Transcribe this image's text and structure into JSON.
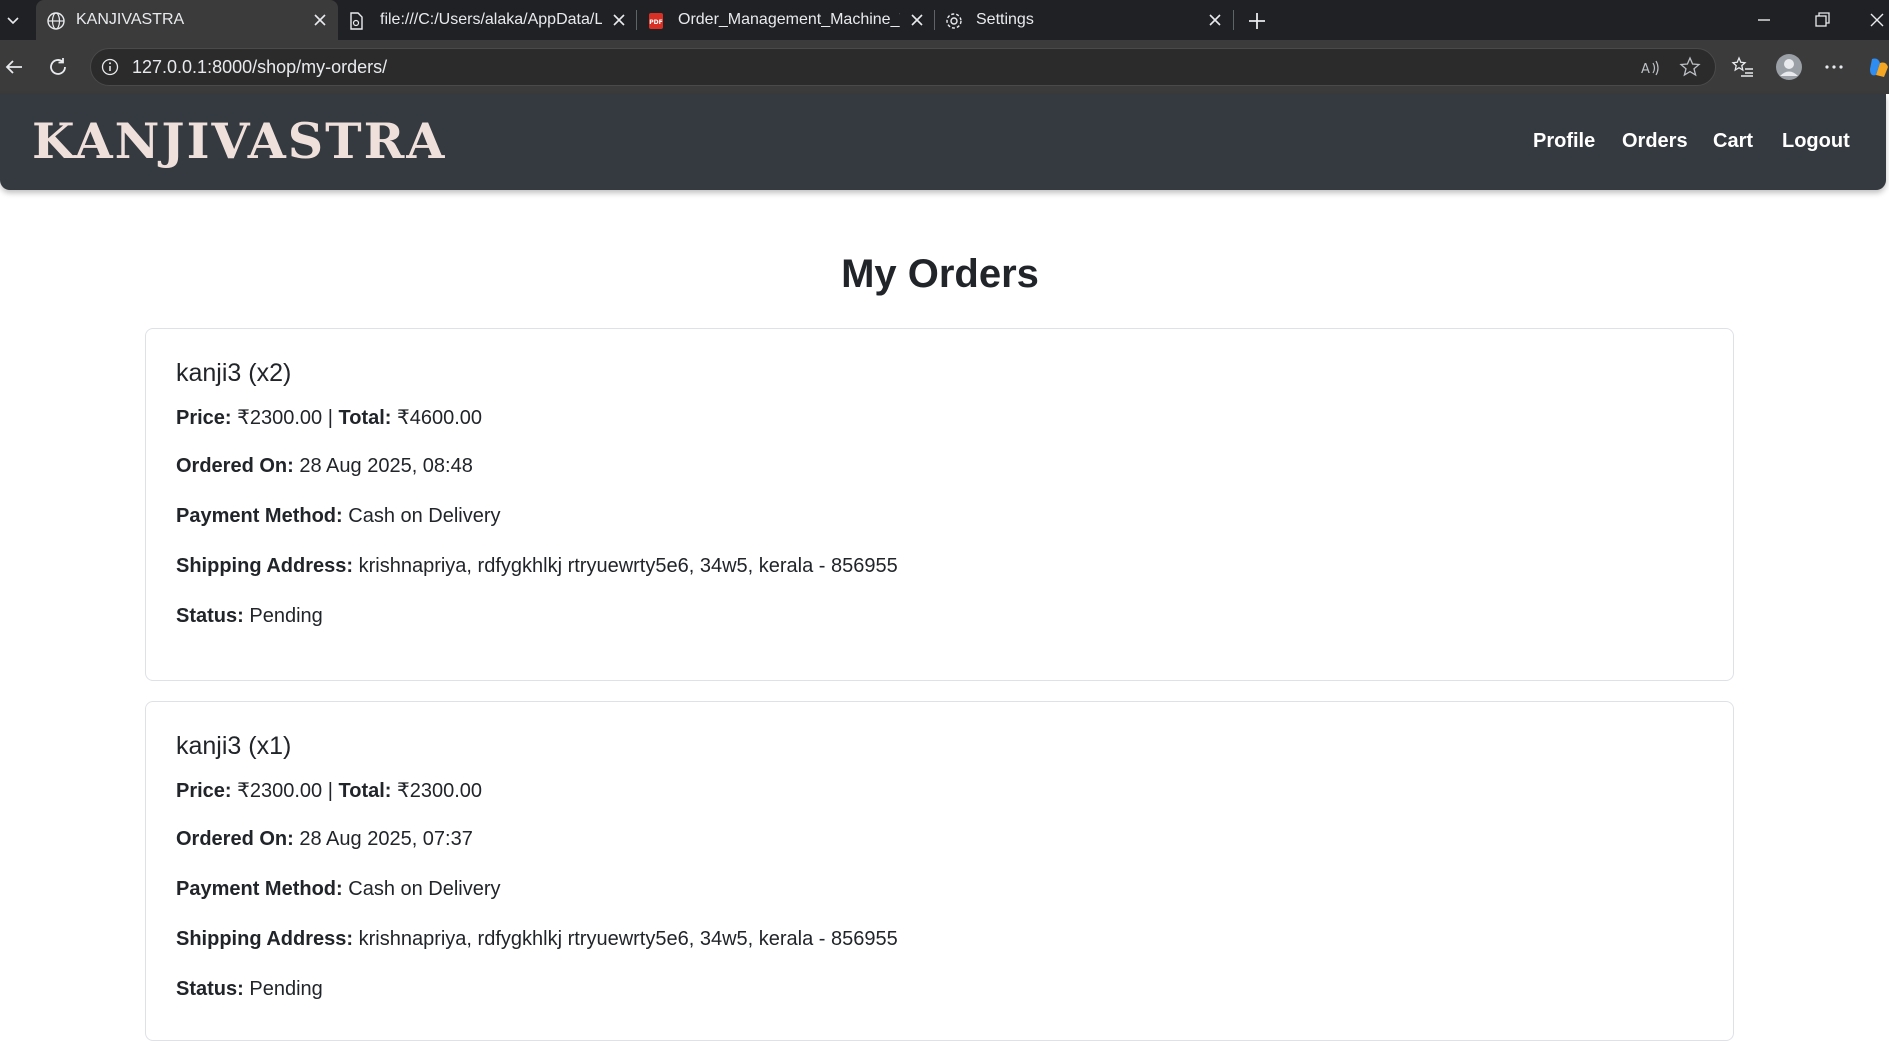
{
  "browser": {
    "tabs": [
      {
        "title": "KANJIVASTRA",
        "icon": "globe-icon",
        "active": true
      },
      {
        "title": "file:///C:/Users/alaka/AppData/Lo",
        "icon": "file-icon",
        "active": false
      },
      {
        "title": "Order_Management_Machine_Tes",
        "icon": "pdf-icon",
        "active": false
      },
      {
        "title": "Settings",
        "icon": "gear-icon",
        "active": false
      }
    ],
    "url": "127.0.0.1:8000/shop/my-orders/"
  },
  "site": {
    "brand": "KANJIVASTRA",
    "nav": [
      "Profile",
      "Orders",
      "Cart",
      "Logout"
    ]
  },
  "page": {
    "title": "My Orders"
  },
  "labels": {
    "price": "Price:",
    "separator": "|",
    "total": "Total:",
    "ordered_on": "Ordered On:",
    "payment_method": "Payment Method:",
    "shipping_address": "Shipping Address:",
    "status": "Status:"
  },
  "orders": [
    {
      "item": "kanji3 (x2)",
      "price": "₹2300.00",
      "total": "₹4600.00",
      "ordered_on": "28 Aug 2025, 08:48",
      "payment_method": "Cash on Delivery",
      "shipping_address": "krishnapriya, rdfygkhlkj rtryuewrty5e6, 34w5, kerala - 856955",
      "status": "Pending"
    },
    {
      "item": "kanji3 (x1)",
      "price": "₹2300.00",
      "total": "₹2300.00",
      "ordered_on": "28 Aug 2025, 07:37",
      "payment_method": "Cash on Delivery",
      "shipping_address": "krishnapriya, rdfygkhlkj rtryuewrty5e6, 34w5, kerala - 856955",
      "status": "Pending"
    }
  ],
  "colors": {
    "header_bg": "#343a40",
    "brand_text": "#f0e0dc",
    "browser_chrome": "#202124"
  }
}
